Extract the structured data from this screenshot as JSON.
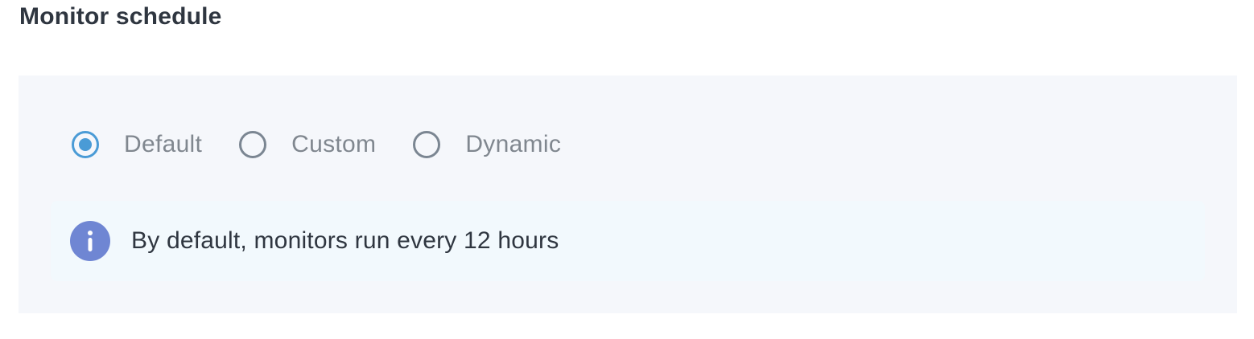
{
  "section": {
    "title": "Monitor schedule"
  },
  "schedule_options": {
    "selected": "Default",
    "items": [
      {
        "label": "Default",
        "checked": true
      },
      {
        "label": "Custom",
        "checked": false
      },
      {
        "label": "Dynamic",
        "checked": false
      }
    ]
  },
  "info": {
    "icon": "info-icon",
    "text": "By default, monitors run every 12 hours"
  },
  "colors": {
    "accent": "#4a9bd6",
    "info_icon": "#6f86d3",
    "panel_bg": "#f5f7fb",
    "info_bg": "#f2f9fd"
  }
}
